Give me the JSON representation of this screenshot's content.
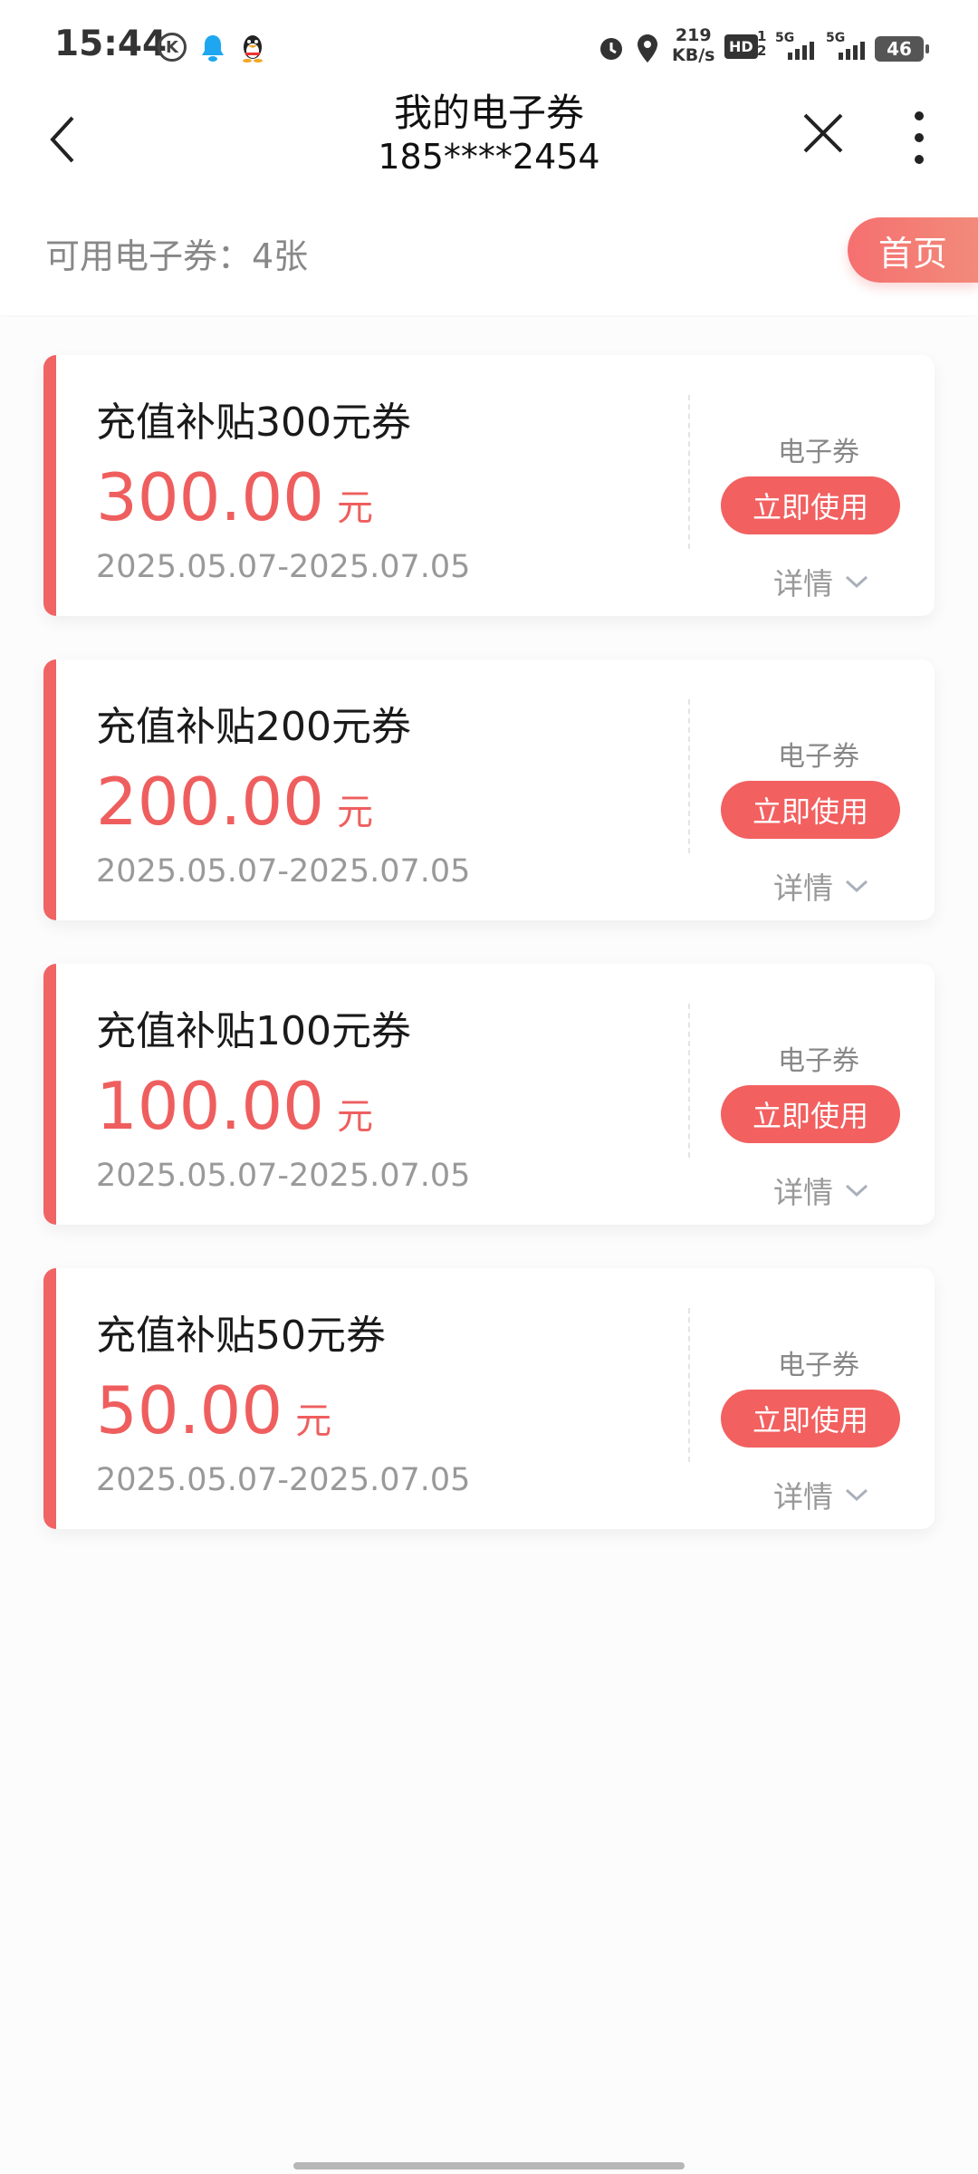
{
  "status_bar": {
    "time": "15:44",
    "net_speed_value": "219",
    "net_speed_unit": "KB/s",
    "hd_label": "HD",
    "hd_sub_top": "1",
    "hd_sub_bottom": "2",
    "sig1_label": "5G",
    "sig2_label": "5G",
    "battery": "46"
  },
  "header": {
    "title": "我的电子券",
    "phone": "185****2454"
  },
  "summary": {
    "available_text": "可用电子券：4张",
    "home_button": "首页"
  },
  "coupons": [
    {
      "name": "充值补贴300元券",
      "amount": "300.00",
      "unit": "元",
      "validity": "2025.05.07-2025.07.05",
      "type": "电子券",
      "use_label": "立即使用",
      "detail_label": "详情"
    },
    {
      "name": "充值补贴200元券",
      "amount": "200.00",
      "unit": "元",
      "validity": "2025.05.07-2025.07.05",
      "type": "电子券",
      "use_label": "立即使用",
      "detail_label": "详情"
    },
    {
      "name": "充值补贴100元券",
      "amount": "100.00",
      "unit": "元",
      "validity": "2025.05.07-2025.07.05",
      "type": "电子券",
      "use_label": "立即使用",
      "detail_label": "详情"
    },
    {
      "name": "充值补贴50元券",
      "amount": "50.00",
      "unit": "元",
      "validity": "2025.05.07-2025.07.05",
      "type": "电子券",
      "use_label": "立即使用",
      "detail_label": "详情"
    }
  ],
  "colors": {
    "accent": "#f06464",
    "amount_text": "#ef5e5e",
    "muted_text": "#999999"
  },
  "icons": [
    "k-icon",
    "bell-icon",
    "qq-penguin-icon",
    "alarm-icon",
    "location-icon",
    "signal-icon",
    "battery-icon",
    "back-arrow-icon",
    "close-icon",
    "more-vertical-icon",
    "chevron-down-icon"
  ]
}
